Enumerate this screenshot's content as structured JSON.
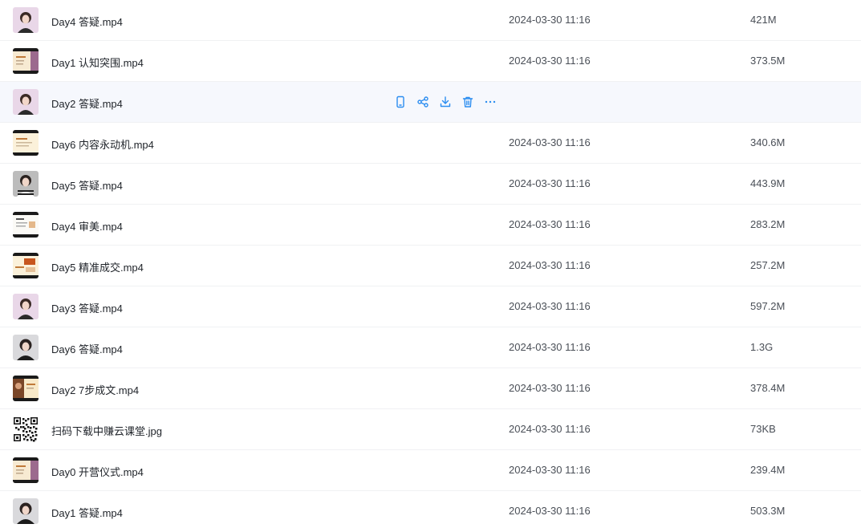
{
  "accent_color": "#2b8df0",
  "files": [
    {
      "name": "Day4 答疑.mp4",
      "date": "2024-03-30 11:16",
      "size": "421M",
      "thumb": "person-pink"
    },
    {
      "name": "Day1 认知突围.mp4",
      "date": "2024-03-30 11:16",
      "size": "373.5M",
      "thumb": "slide-pink"
    },
    {
      "name": "Day2 答疑.mp4",
      "date": "",
      "size": "",
      "thumb": "person-pink",
      "hovered": true
    },
    {
      "name": "Day6 内容永动机.mp4",
      "date": "2024-03-30 11:16",
      "size": "340.6M",
      "thumb": "slide-cream"
    },
    {
      "name": "Day5 答疑.mp4",
      "date": "2024-03-30 11:16",
      "size": "443.9M",
      "thumb": "person-stripe"
    },
    {
      "name": "Day4 审美.mp4",
      "date": "2024-03-30 11:16",
      "size": "283.2M",
      "thumb": "slide-white"
    },
    {
      "name": "Day5 精准成交.mp4",
      "date": "2024-03-30 11:16",
      "size": "257.2M",
      "thumb": "slide-orange"
    },
    {
      "name": "Day3 答疑.mp4",
      "date": "2024-03-30 11:16",
      "size": "597.2M",
      "thumb": "person-pink"
    },
    {
      "name": "Day6 答疑.mp4",
      "date": "2024-03-30 11:16",
      "size": "1.3G",
      "thumb": "person-gray"
    },
    {
      "name": "Day2 7步成文.mp4",
      "date": "2024-03-30 11:16",
      "size": "378.4M",
      "thumb": "slide-brown"
    },
    {
      "name": "扫码下载中赚云课堂.jpg",
      "date": "2024-03-30 11:16",
      "size": "73KB",
      "thumb": "qr-code"
    },
    {
      "name": "Day0 开营仪式.mp4",
      "date": "2024-03-30 11:16",
      "size": "239.4M",
      "thumb": "slide-pink"
    },
    {
      "name": "Day1 答疑.mp4",
      "date": "2024-03-30 11:16",
      "size": "503.3M",
      "thumb": "person-gray"
    }
  ],
  "hover_actions": [
    "phone-icon",
    "share-icon",
    "download-icon",
    "delete-icon",
    "more-icon"
  ]
}
